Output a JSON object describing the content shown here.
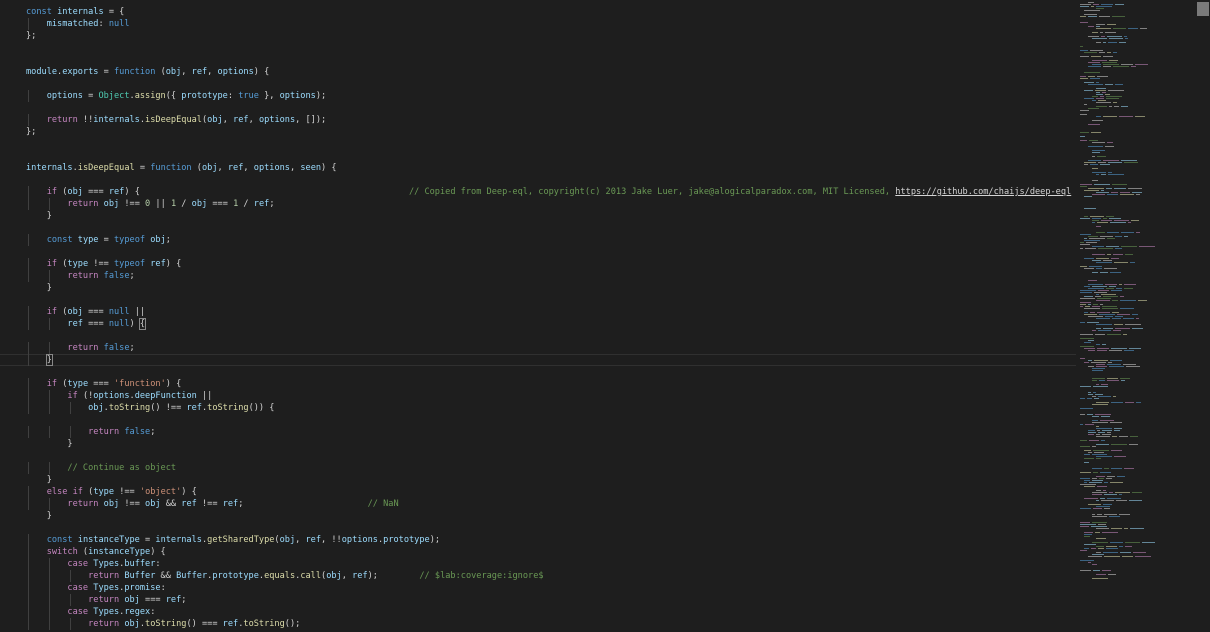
{
  "theme": {
    "background": "#1e1e1e",
    "keyword": "#569cd6",
    "control": "#c586c0",
    "variable": "#9cdcfe",
    "function": "#dcdcaa",
    "type": "#4ec9b0",
    "string": "#ce9178",
    "number": "#b5cea8",
    "comment": "#6a9955",
    "plain": "#d4d4d4",
    "link": "#d4d4d4"
  },
  "editor": {
    "current_line_index": 29,
    "lines": [
      [
        [
          "const",
          "k"
        ],
        [
          " "
        ],
        [
          "internals",
          "v"
        ],
        [
          " = {"
        ]
      ],
      [
        [
          "    "
        ],
        [
          "mismatched",
          "v"
        ],
        [
          ": "
        ],
        [
          "null",
          "k"
        ]
      ],
      [
        [
          "};"
        ]
      ],
      [],
      [],
      [
        [
          "module",
          "v"
        ],
        [
          "."
        ],
        [
          "exports",
          "v"
        ],
        [
          " = "
        ],
        [
          "function",
          "k"
        ],
        [
          " ("
        ],
        [
          "obj",
          "v"
        ],
        [
          ", "
        ],
        [
          "ref",
          "v"
        ],
        [
          ", "
        ],
        [
          "options",
          "v"
        ],
        [
          ") {"
        ]
      ],
      [],
      [
        [
          "    "
        ],
        [
          "options",
          "v"
        ],
        [
          " = "
        ],
        [
          "Object",
          "t"
        ],
        [
          "."
        ],
        [
          "assign",
          "f"
        ],
        [
          "({ "
        ],
        [
          "prototype",
          "v"
        ],
        [
          ": "
        ],
        [
          "true",
          "k"
        ],
        [
          " }, "
        ],
        [
          "options",
          "v"
        ],
        [
          ");"
        ]
      ],
      [],
      [
        [
          "    "
        ],
        [
          "return",
          "c"
        ],
        [
          " !!"
        ],
        [
          "internals",
          "v"
        ],
        [
          "."
        ],
        [
          "isDeepEqual",
          "f"
        ],
        [
          "("
        ],
        [
          "obj",
          "v"
        ],
        [
          ", "
        ],
        [
          "ref",
          "v"
        ],
        [
          ", "
        ],
        [
          "options",
          "v"
        ],
        [
          ", []);"
        ]
      ],
      [
        [
          "};"
        ]
      ],
      [],
      [],
      [
        [
          "internals",
          "v"
        ],
        [
          "."
        ],
        [
          "isDeepEqual",
          "f"
        ],
        [
          " = "
        ],
        [
          "function",
          "k"
        ],
        [
          " ("
        ],
        [
          "obj",
          "v"
        ],
        [
          ", "
        ],
        [
          "ref",
          "v"
        ],
        [
          ", "
        ],
        [
          "options",
          "v"
        ],
        [
          ", "
        ],
        [
          "seen",
          "v"
        ],
        [
          ") {"
        ]
      ],
      [],
      [
        [
          "    "
        ],
        [
          "if",
          "c"
        ],
        [
          " ("
        ],
        [
          "obj",
          "v"
        ],
        [
          " === "
        ],
        [
          "ref",
          "v"
        ],
        [
          ") {                                                    "
        ],
        [
          "// Copied from Deep-eql, copyright(c) 2013 Jake Luer, jake@alogicalparadox.com, MIT Licensed, ",
          "m"
        ],
        [
          "https://github.com/chaijs/deep-eql",
          "l"
        ]
      ],
      [
        [
          "        "
        ],
        [
          "return",
          "c"
        ],
        [
          " "
        ],
        [
          "obj",
          "v"
        ],
        [
          " !== "
        ],
        [
          "0",
          "n"
        ],
        [
          " || "
        ],
        [
          "1",
          "n"
        ],
        [
          " / "
        ],
        [
          "obj",
          "v"
        ],
        [
          " === "
        ],
        [
          "1",
          "n"
        ],
        [
          " / "
        ],
        [
          "ref",
          "v"
        ],
        [
          ";"
        ]
      ],
      [
        [
          "    }"
        ]
      ],
      [],
      [
        [
          "    "
        ],
        [
          "const",
          "k"
        ],
        [
          " "
        ],
        [
          "type",
          "v"
        ],
        [
          " = "
        ],
        [
          "typeof",
          "k"
        ],
        [
          " "
        ],
        [
          "obj",
          "v"
        ],
        [
          ";"
        ]
      ],
      [],
      [
        [
          "    "
        ],
        [
          "if",
          "c"
        ],
        [
          " ("
        ],
        [
          "type",
          "v"
        ],
        [
          " !== "
        ],
        [
          "typeof",
          "k"
        ],
        [
          " "
        ],
        [
          "ref",
          "v"
        ],
        [
          ") {"
        ]
      ],
      [
        [
          "        "
        ],
        [
          "return",
          "c"
        ],
        [
          " "
        ],
        [
          "false",
          "k"
        ],
        [
          ";"
        ]
      ],
      [
        [
          "    }"
        ]
      ],
      [],
      [
        [
          "    "
        ],
        [
          "if",
          "c"
        ],
        [
          " ("
        ],
        [
          "obj",
          "v"
        ],
        [
          " === "
        ],
        [
          "null",
          "k"
        ],
        [
          " ||"
        ]
      ],
      [
        [
          "        "
        ],
        [
          "ref",
          "v"
        ],
        [
          " === "
        ],
        [
          "null",
          "k"
        ],
        [
          ") "
        ],
        [
          "{",
          "b"
        ]
      ],
      [],
      [
        [
          "        "
        ],
        [
          "return",
          "c"
        ],
        [
          " "
        ],
        [
          "false",
          "k"
        ],
        [
          ";"
        ]
      ],
      [
        [
          "    "
        ],
        [
          "}",
          "b"
        ]
      ],
      [],
      [
        [
          "    "
        ],
        [
          "if",
          "c"
        ],
        [
          " ("
        ],
        [
          "type",
          "v"
        ],
        [
          " === "
        ],
        [
          "'function'",
          "s"
        ],
        [
          ") {"
        ]
      ],
      [
        [
          "        "
        ],
        [
          "if",
          "c"
        ],
        [
          " (!"
        ],
        [
          "options",
          "v"
        ],
        [
          "."
        ],
        [
          "deepFunction",
          "v"
        ],
        [
          " ||"
        ]
      ],
      [
        [
          "            "
        ],
        [
          "obj",
          "v"
        ],
        [
          "."
        ],
        [
          "toString",
          "f"
        ],
        [
          "() !== "
        ],
        [
          "ref",
          "v"
        ],
        [
          "."
        ],
        [
          "toString",
          "f"
        ],
        [
          "()) {"
        ]
      ],
      [],
      [
        [
          "            "
        ],
        [
          "return",
          "c"
        ],
        [
          " "
        ],
        [
          "false",
          "k"
        ],
        [
          ";"
        ]
      ],
      [
        [
          "        }"
        ]
      ],
      [],
      [
        [
          "        "
        ],
        [
          "// Continue as object",
          "m"
        ]
      ],
      [
        [
          "    }"
        ]
      ],
      [
        [
          "    "
        ],
        [
          "else",
          "c"
        ],
        [
          " "
        ],
        [
          "if",
          "c"
        ],
        [
          " ("
        ],
        [
          "type",
          "v"
        ],
        [
          " !== "
        ],
        [
          "'object'",
          "s"
        ],
        [
          ") {"
        ]
      ],
      [
        [
          "        "
        ],
        [
          "return",
          "c"
        ],
        [
          " "
        ],
        [
          "obj",
          "v"
        ],
        [
          " !== "
        ],
        [
          "obj",
          "v"
        ],
        [
          " && "
        ],
        [
          "ref",
          "v"
        ],
        [
          " !== "
        ],
        [
          "ref",
          "v"
        ],
        [
          ";                        "
        ],
        [
          "// NaN",
          "m"
        ]
      ],
      [
        [
          "    }"
        ]
      ],
      [],
      [
        [
          "    "
        ],
        [
          "const",
          "k"
        ],
        [
          " "
        ],
        [
          "instanceType",
          "v"
        ],
        [
          " = "
        ],
        [
          "internals",
          "v"
        ],
        [
          "."
        ],
        [
          "getSharedType",
          "f"
        ],
        [
          "("
        ],
        [
          "obj",
          "v"
        ],
        [
          ", "
        ],
        [
          "ref",
          "v"
        ],
        [
          ", !!"
        ],
        [
          "options",
          "v"
        ],
        [
          "."
        ],
        [
          "prototype",
          "v"
        ],
        [
          ");"
        ]
      ],
      [
        [
          "    "
        ],
        [
          "switch",
          "c"
        ],
        [
          " ("
        ],
        [
          "instanceType",
          "v"
        ],
        [
          ") {"
        ]
      ],
      [
        [
          "        "
        ],
        [
          "case",
          "c"
        ],
        [
          " "
        ],
        [
          "Types",
          "v"
        ],
        [
          "."
        ],
        [
          "buffer",
          "v"
        ],
        [
          ":"
        ]
      ],
      [
        [
          "            "
        ],
        [
          "return",
          "c"
        ],
        [
          " "
        ],
        [
          "Buffer",
          "v"
        ],
        [
          " && "
        ],
        [
          "Buffer",
          "v"
        ],
        [
          "."
        ],
        [
          "prototype",
          "v"
        ],
        [
          "."
        ],
        [
          "equals",
          "f"
        ],
        [
          "."
        ],
        [
          "call",
          "f"
        ],
        [
          "("
        ],
        [
          "obj",
          "v"
        ],
        [
          ", "
        ],
        [
          "ref",
          "v"
        ],
        [
          ");        "
        ],
        [
          "// $lab:coverage:ignore$",
          "m"
        ]
      ],
      [
        [
          "        "
        ],
        [
          "case",
          "c"
        ],
        [
          " "
        ],
        [
          "Types",
          "v"
        ],
        [
          "."
        ],
        [
          "promise",
          "v"
        ],
        [
          ":"
        ]
      ],
      [
        [
          "            "
        ],
        [
          "return",
          "c"
        ],
        [
          " "
        ],
        [
          "obj",
          "v"
        ],
        [
          " === "
        ],
        [
          "ref",
          "v"
        ],
        [
          ";"
        ]
      ],
      [
        [
          "        "
        ],
        [
          "case",
          "c"
        ],
        [
          " "
        ],
        [
          "Types",
          "v"
        ],
        [
          "."
        ],
        [
          "regex",
          "v"
        ],
        [
          ":"
        ]
      ],
      [
        [
          "            "
        ],
        [
          "return",
          "c"
        ],
        [
          " "
        ],
        [
          "obj",
          "v"
        ],
        [
          "."
        ],
        [
          "toString",
          "f"
        ],
        [
          "() === "
        ],
        [
          "ref",
          "v"
        ],
        [
          "."
        ],
        [
          "toString",
          "f"
        ],
        [
          "();"
        ]
      ]
    ]
  },
  "minimap": {
    "note_colors": [
      "#569cd6",
      "#9cdcfe",
      "#d4d4d4",
      "#6a9955",
      "#c586c0",
      "#dcdcaa"
    ]
  }
}
